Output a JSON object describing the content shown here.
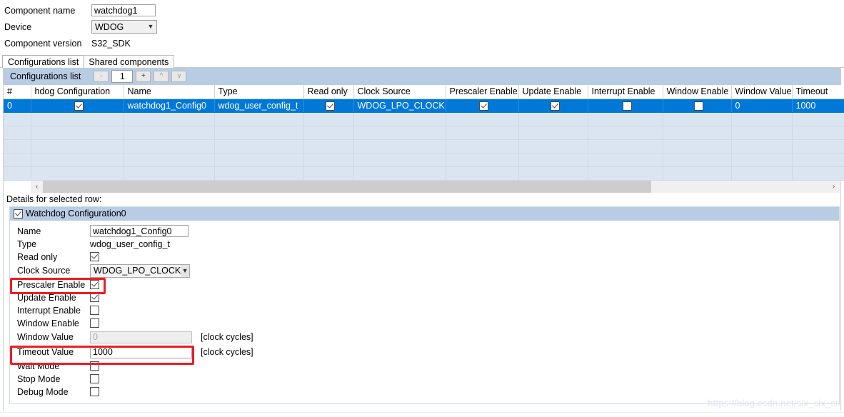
{
  "header": {
    "component_name_label": "Component name",
    "component_name_value": "watchdog1",
    "device_label": "Device",
    "device_value": "WDOG",
    "component_version_label": "Component version",
    "component_version_value": "S32_SDK"
  },
  "tabs": [
    {
      "label": "Configurations list",
      "active": true
    },
    {
      "label": "Shared components",
      "active": false
    }
  ],
  "configurations_list": {
    "title": "Configurations list",
    "remove_label": "-",
    "count_value": "1",
    "add_label": "+",
    "up_label": "^",
    "down_label": "v"
  },
  "table": {
    "columns": [
      "#",
      "hdog Configuration",
      "Name",
      "Type",
      "Read only",
      "Clock Source",
      "Prescaler Enable",
      "Update Enable",
      "Interrupt Enable",
      "Window Enable",
      "Window Value",
      "Timeout"
    ],
    "selected_row": {
      "index": "0",
      "hdog_configuration": true,
      "name": "watchdog1_Config0",
      "type": "wdog_user_config_t",
      "read_only": true,
      "clock_source": "WDOG_LPO_CLOCK",
      "prescaler_enable": true,
      "update_enable": true,
      "interrupt_enable": false,
      "window_enable": false,
      "window_value": "0",
      "timeout": "1000"
    },
    "empty_row_count": 5,
    "scroll_left_icon": "‹",
    "scroll_right_icon": "›"
  },
  "details": {
    "caption": "Details for selected row:",
    "header_title": "Watchdog Configuration0",
    "header_checked": true,
    "fields": {
      "name_label": "Name",
      "name_value": "watchdog1_Config0",
      "type_label": "Type",
      "type_value": "wdog_user_config_t",
      "read_only_label": "Read only",
      "read_only_checked": true,
      "clock_source_label": "Clock Source",
      "clock_source_value": "WDOG_LPO_CLOCK",
      "prescaler_enable_label": "Prescaler Enable",
      "prescaler_enable_checked": true,
      "update_enable_label": "Update Enable",
      "update_enable_checked": true,
      "interrupt_enable_label": "Interrupt Enable",
      "interrupt_enable_checked": false,
      "window_enable_label": "Window Enable",
      "window_enable_checked": false,
      "window_value_label": "Window Value",
      "window_value_value": "0",
      "window_value_unit": "[clock cycles]",
      "timeout_value_label": "Timeout Value",
      "timeout_value_value": "1000",
      "timeout_value_unit": "[clock cycles]",
      "wait_mode_label": "Wait Mode",
      "wait_mode_checked": false,
      "stop_mode_label": "Stop Mode",
      "stop_mode_checked": false,
      "debug_mode_label": "Debug Mode",
      "debug_mode_checked": false
    }
  },
  "annotations": {
    "highlight_color": "#ee1c25",
    "boxes": [
      "prescaler-enable-row",
      "timeout-value-row"
    ]
  },
  "watermark": "https://blog.csdn.net/six_six_six"
}
